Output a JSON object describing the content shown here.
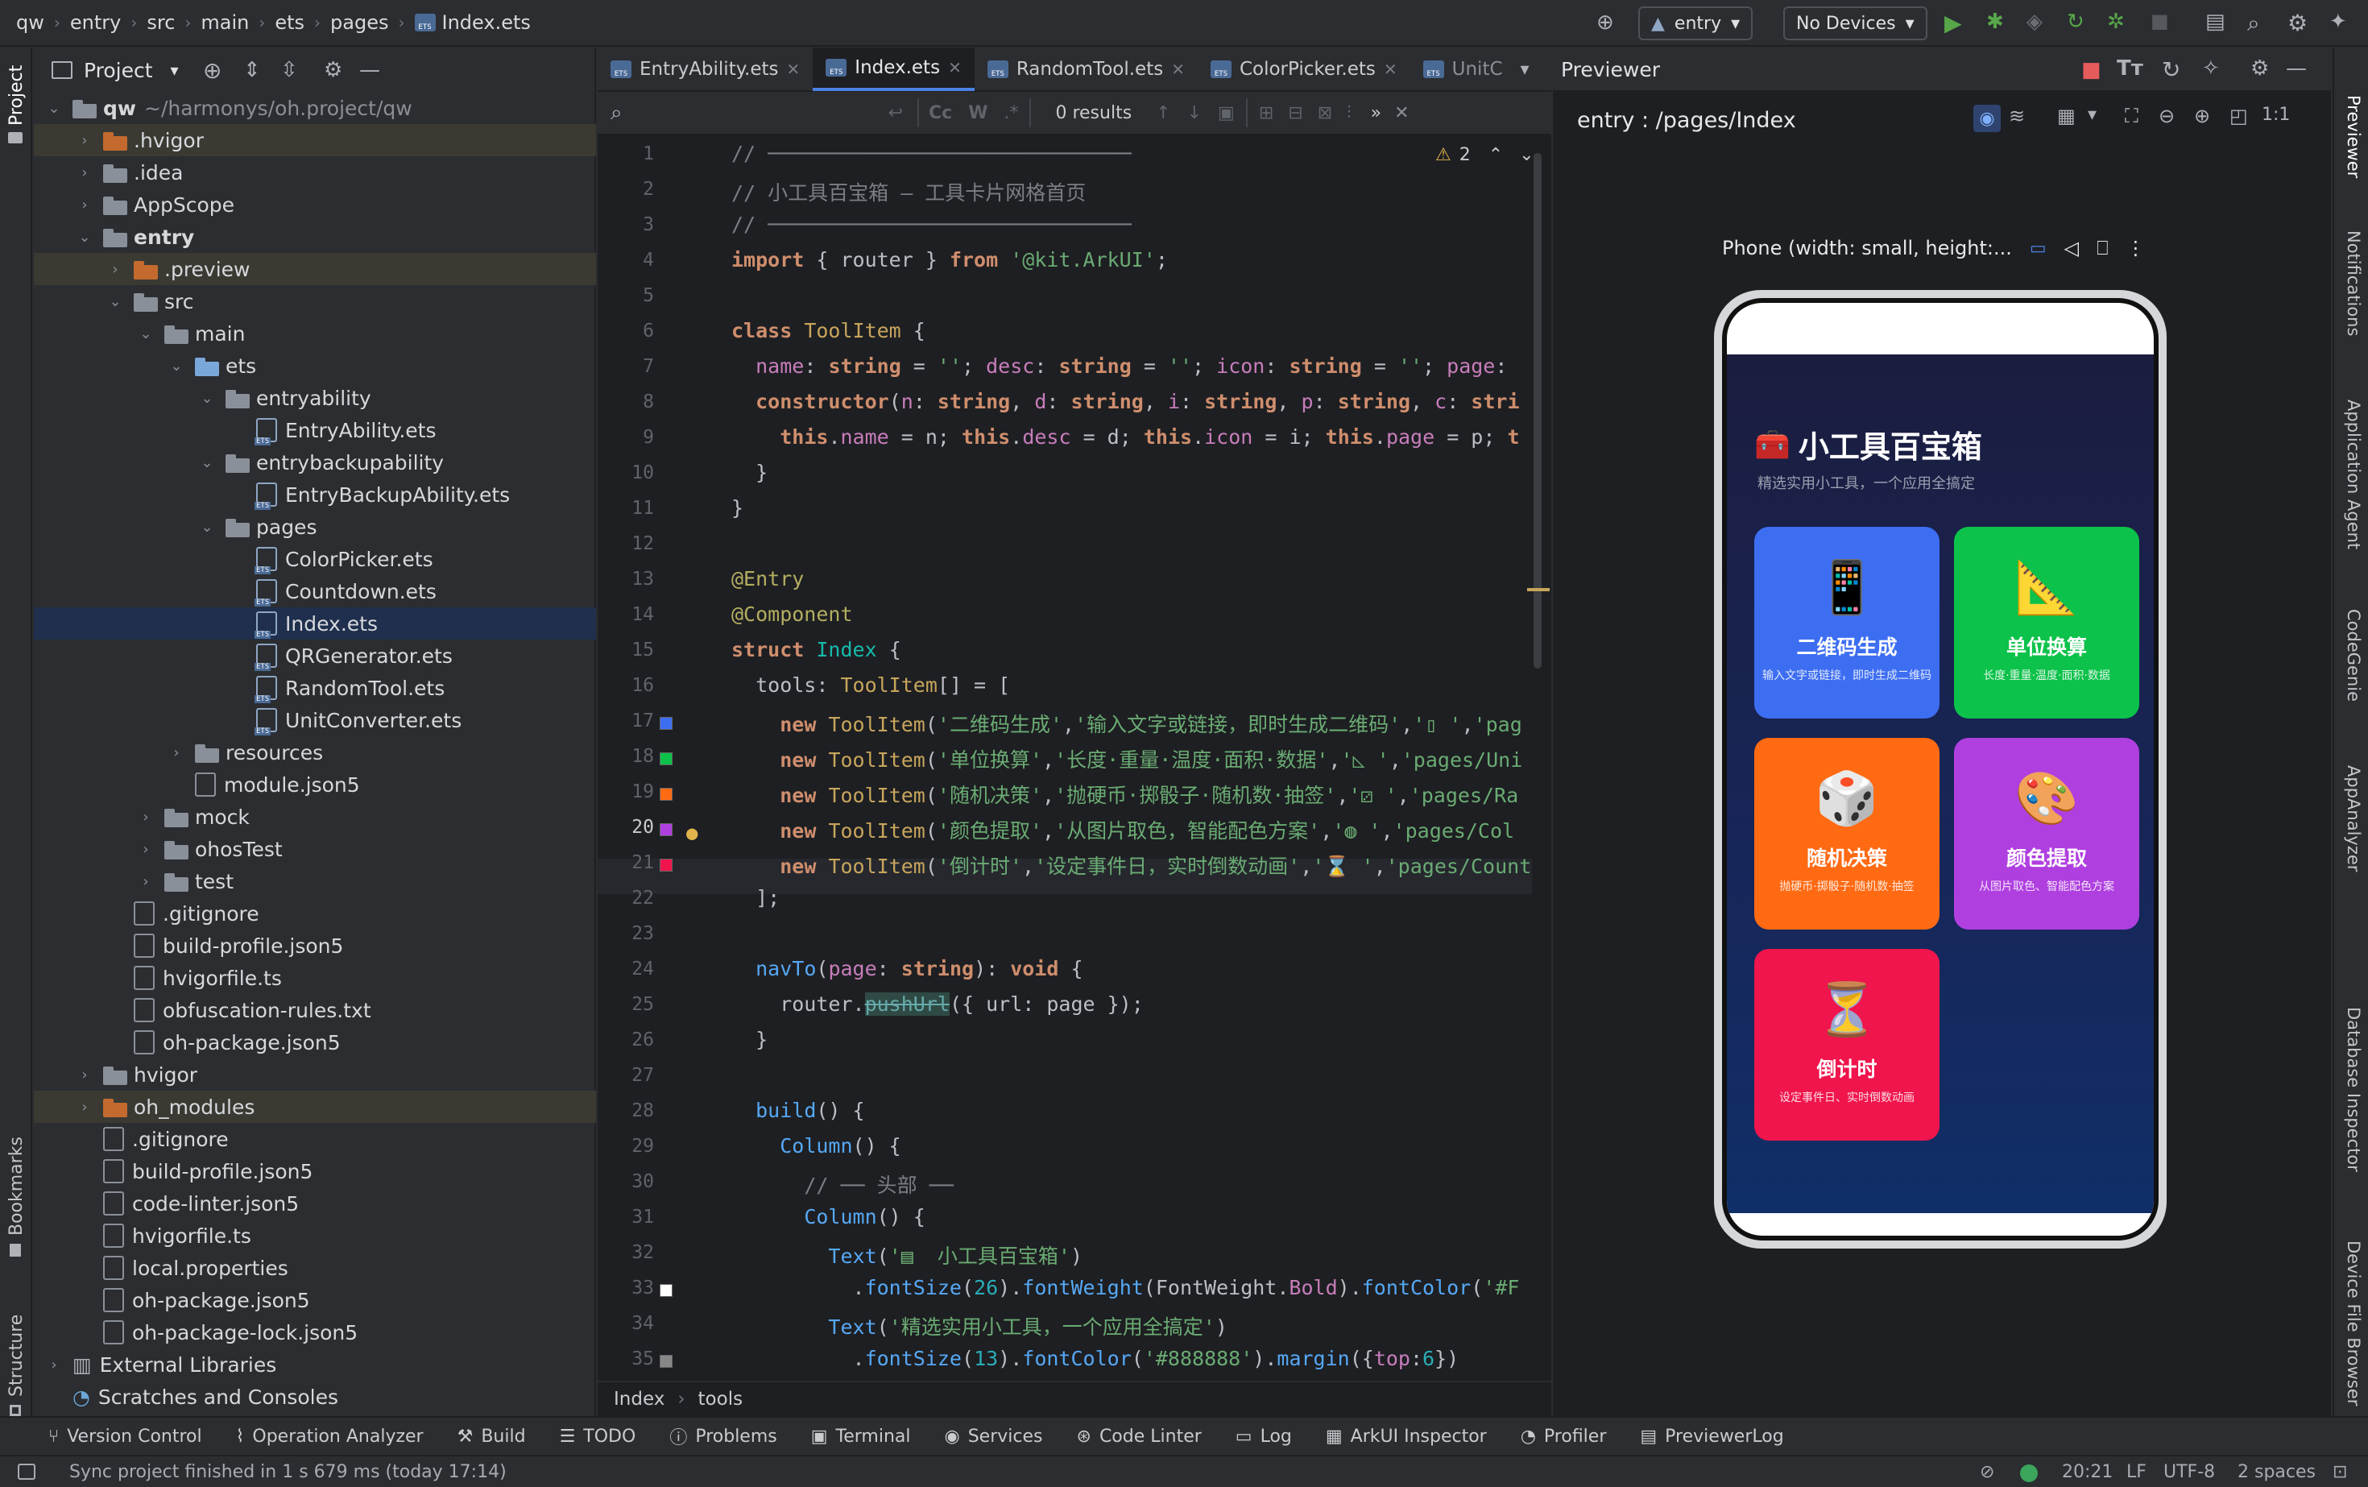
{
  "topbar": {
    "breadcrumbs": [
      "qw",
      "entry",
      "src",
      "main",
      "ets",
      "pages",
      "Index.ets"
    ],
    "run_config": "entry",
    "device": "No Devices"
  },
  "left_strip": {
    "project": "Project",
    "bookmarks": "Bookmarks",
    "structure": "Structure"
  },
  "project_panel": {
    "title": "Project",
    "tree": [
      {
        "label": "qw",
        "extra": "~/harmonys/oh.project/qw",
        "depth": 0,
        "kind": "folder",
        "arrow": "open",
        "bold": true
      },
      {
        "label": ".hvigor",
        "depth": 1,
        "kind": "folder-orange",
        "arrow": "closed",
        "hl": true
      },
      {
        "label": ".idea",
        "depth": 1,
        "kind": "folder",
        "arrow": "closed"
      },
      {
        "label": "AppScope",
        "depth": 1,
        "kind": "folder",
        "arrow": "closed"
      },
      {
        "label": "entry",
        "depth": 1,
        "kind": "folder",
        "arrow": "open",
        "bold": true
      },
      {
        "label": ".preview",
        "depth": 2,
        "kind": "folder-orange",
        "arrow": "closed",
        "hl": true
      },
      {
        "label": "src",
        "depth": 2,
        "kind": "folder",
        "arrow": "open"
      },
      {
        "label": "main",
        "depth": 3,
        "kind": "folder",
        "arrow": "open"
      },
      {
        "label": "ets",
        "depth": 4,
        "kind": "folder-blue",
        "arrow": "open"
      },
      {
        "label": "entryability",
        "depth": 5,
        "kind": "folder",
        "arrow": "open"
      },
      {
        "label": "EntryAbility.ets",
        "depth": 6,
        "kind": "ets"
      },
      {
        "label": "entrybackupability",
        "depth": 5,
        "kind": "folder",
        "arrow": "open"
      },
      {
        "label": "EntryBackupAbility.ets",
        "depth": 6,
        "kind": "ets"
      },
      {
        "label": "pages",
        "depth": 5,
        "kind": "folder",
        "arrow": "open"
      },
      {
        "label": "ColorPicker.ets",
        "depth": 6,
        "kind": "ets"
      },
      {
        "label": "Countdown.ets",
        "depth": 6,
        "kind": "ets"
      },
      {
        "label": "Index.ets",
        "depth": 6,
        "kind": "ets",
        "sel": true
      },
      {
        "label": "QRGenerator.ets",
        "depth": 6,
        "kind": "ets"
      },
      {
        "label": "RandomTool.ets",
        "depth": 6,
        "kind": "ets"
      },
      {
        "label": "UnitConverter.ets",
        "depth": 6,
        "kind": "ets"
      },
      {
        "label": "resources",
        "depth": 4,
        "kind": "folder",
        "arrow": "closed"
      },
      {
        "label": "module.json5",
        "depth": 4,
        "kind": "file"
      },
      {
        "label": "mock",
        "depth": 3,
        "kind": "folder",
        "arrow": "closed"
      },
      {
        "label": "ohosTest",
        "depth": 3,
        "kind": "folder",
        "arrow": "closed"
      },
      {
        "label": "test",
        "depth": 3,
        "kind": "folder",
        "arrow": "closed"
      },
      {
        "label": ".gitignore",
        "depth": 2,
        "kind": "file"
      },
      {
        "label": "build-profile.json5",
        "depth": 2,
        "kind": "file"
      },
      {
        "label": "hvigorfile.ts",
        "depth": 2,
        "kind": "file"
      },
      {
        "label": "obfuscation-rules.txt",
        "depth": 2,
        "kind": "file"
      },
      {
        "label": "oh-package.json5",
        "depth": 2,
        "kind": "file"
      },
      {
        "label": "hvigor",
        "depth": 1,
        "kind": "folder",
        "arrow": "closed"
      },
      {
        "label": "oh_modules",
        "depth": 1,
        "kind": "folder-orange",
        "arrow": "closed",
        "hl": true
      },
      {
        "label": ".gitignore",
        "depth": 1,
        "kind": "file"
      },
      {
        "label": "build-profile.json5",
        "depth": 1,
        "kind": "file"
      },
      {
        "label": "code-linter.json5",
        "depth": 1,
        "kind": "file"
      },
      {
        "label": "hvigorfile.ts",
        "depth": 1,
        "kind": "file"
      },
      {
        "label": "local.properties",
        "depth": 1,
        "kind": "file"
      },
      {
        "label": "oh-package.json5",
        "depth": 1,
        "kind": "file"
      },
      {
        "label": "oh-package-lock.json5",
        "depth": 1,
        "kind": "file"
      },
      {
        "label": "External Libraries",
        "depth": 0,
        "kind": "lib",
        "arrow": "closed"
      },
      {
        "label": "Scratches and Consoles",
        "depth": 0,
        "kind": "scratch"
      }
    ]
  },
  "editor": {
    "tabs": [
      "EntryAbility.ets",
      "Index.ets",
      "RandomTool.ets",
      "ColorPicker.ets",
      "UnitC"
    ],
    "active_tab": 1,
    "find": {
      "case": "Cc",
      "word": "W",
      "regex": ".*",
      "results": "0 results"
    },
    "warnings": "2",
    "current_line": 20,
    "breadcrumb": [
      "Index",
      "tools"
    ]
  },
  "previewer": {
    "title": "Previewer",
    "path": "entry : /pages/Index",
    "device_label": "Phone (width: small, height:..."
  },
  "app": {
    "title_icon": "🧰",
    "title": "小工具百宝箱",
    "subtitle": "精选实用小工具，一个应用全搞定",
    "cards": [
      {
        "emoji": "📱",
        "name": "二维码生成",
        "desc": "输入文字或链接，即时生成二维码",
        "color": "#3d6ef2"
      },
      {
        "emoji": "📐",
        "name": "单位换算",
        "desc": "长度·重量·温度·面积·数据",
        "color": "#0cc24a"
      },
      {
        "emoji": "🎲",
        "name": "随机决策",
        "desc": "抛硬币·掷骰子·随机数·抽签",
        "color": "#ff6a13"
      },
      {
        "emoji": "🎨",
        "name": "颜色提取",
        "desc": "从图片取色、智能配色方案",
        "color": "#b03fe0"
      },
      {
        "emoji": "⏳",
        "name": "倒计时",
        "desc": "设定事件日、实时倒数动画",
        "color": "#f0154c"
      }
    ]
  },
  "right_strip": [
    "Previewer",
    "Notifications",
    "Application Agent",
    "CodeGenie",
    "AppAnalyzer",
    "Database Inspector",
    "Device File Browser"
  ],
  "bottom_tools": [
    "Version Control",
    "Operation Analyzer",
    "Build",
    "TODO",
    "Problems",
    "Terminal",
    "Services",
    "Code Linter",
    "Log",
    "ArkUI Inspector",
    "Profiler",
    "PreviewerLog"
  ],
  "status": {
    "message": "Sync project finished in 1 s 679 ms (today 17:14)",
    "position": "20:21",
    "line_ending": "LF",
    "encoding": "UTF-8",
    "indent": "2 spaces"
  }
}
